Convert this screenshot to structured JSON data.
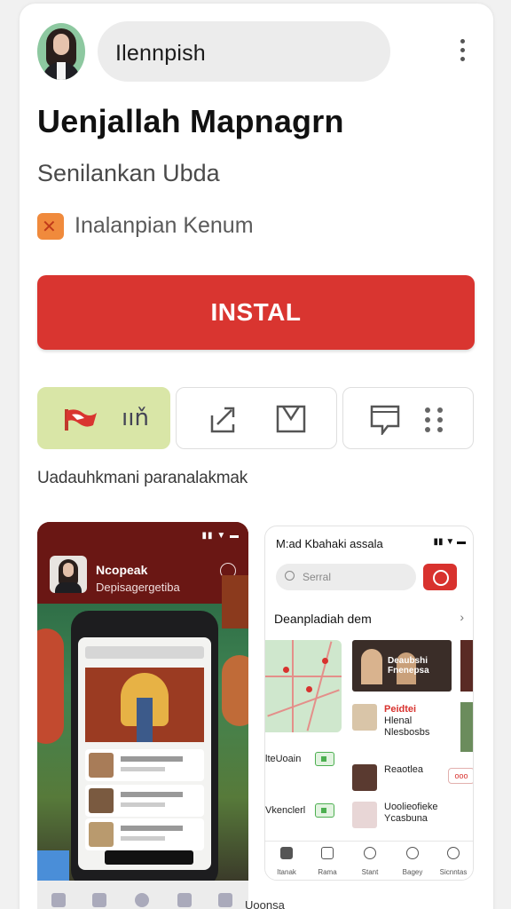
{
  "header": {
    "search_text": "Ilennpish"
  },
  "app": {
    "title": "Uenjallah Mapnagrn",
    "subtitle": "Senilankan Ubda",
    "rating_label": "Inalanpian Kenum",
    "install_label": "INSTAL",
    "description": "Uadauhkmani paranalakmak",
    "action_glyph": "ııň"
  },
  "shot1": {
    "status": "▮▮ ▼ ▬",
    "name": "Ncopeak",
    "sub": "Depisagergetiba"
  },
  "shot2": {
    "title": "M:ad Kbahaki assala",
    "status": "▮▮ ▼ ▬",
    "search_placeholder": "Serral",
    "section": "Deanpladiah dem",
    "news_overlay": "Deaubshi Fnenepsa",
    "item1": {
      "title": "Peidtei",
      "line2": "Hlenal",
      "line3": "Nlesbosbs"
    },
    "item2": {
      "title": "Reaotlea",
      "line2": ""
    },
    "item3": {
      "title": "Uoolieofieke",
      "line2": "Ycasbuna"
    },
    "row_a": "lteUoain",
    "row_b": "Vkenclerl",
    "chip_label": "ooo",
    "nav": [
      "Itanak",
      "Rama",
      "Stant",
      "Bagey",
      "Sicnntas"
    ]
  },
  "footer_peek": "Uoonsa",
  "colors": {
    "install": "#d93530",
    "accent_green": "#d9e6a7"
  }
}
